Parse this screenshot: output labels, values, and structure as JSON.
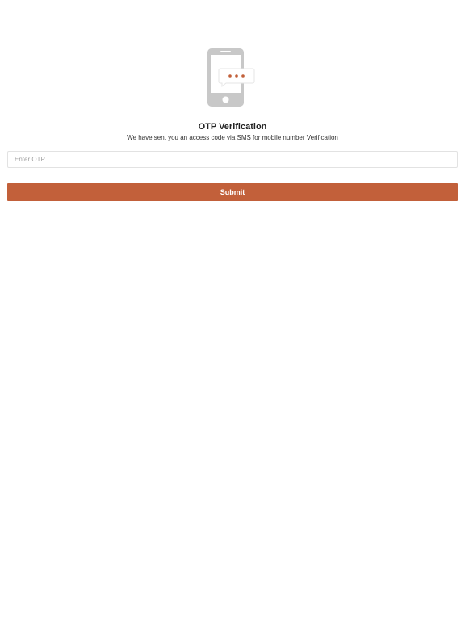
{
  "header": {
    "icon": "phone-sms-icon",
    "title": "OTP Verification",
    "subtitle": "We have sent you an access code via SMS for mobile number Verification"
  },
  "form": {
    "otp_placeholder": "Enter OTP",
    "otp_value": "",
    "submit_label": "Submit"
  },
  "colors": {
    "accent": "#c2603a",
    "icon_gray": "#c8c8c8",
    "background": "#ffffff"
  }
}
